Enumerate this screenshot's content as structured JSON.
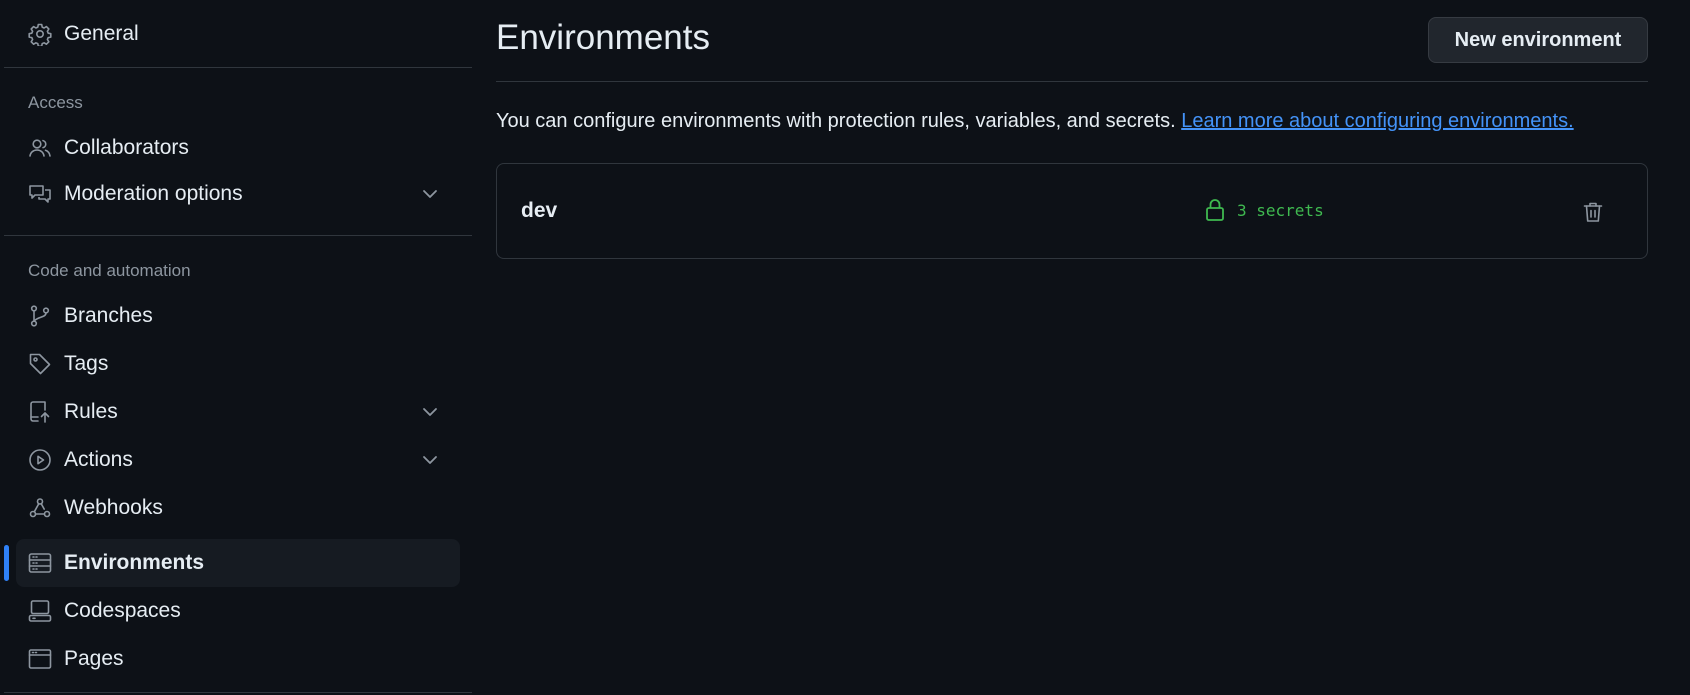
{
  "sidebar": {
    "general": "General",
    "access_heading": "Access",
    "collaborators": "Collaborators",
    "moderation": "Moderation options",
    "code_heading": "Code and automation",
    "branches": "Branches",
    "tags": "Tags",
    "rules": "Rules",
    "actions": "Actions",
    "webhooks": "Webhooks",
    "environments": "Environments",
    "codespaces": "Codespaces",
    "pages": "Pages",
    "active_item": "Environments"
  },
  "main": {
    "title": "Environments",
    "new_button": "New environment",
    "description": "You can configure environments with protection rules, variables, and secrets.",
    "learn_more": "Learn more about configuring environments.",
    "environments": [
      {
        "name": "dev",
        "secrets": "3 secrets"
      }
    ]
  },
  "colors": {
    "background": "#0d1117",
    "accent": "#2f81f7",
    "link": "#4493f8",
    "success": "#3fb950",
    "border": "#30363d"
  },
  "icons": {
    "general": "gear-icon",
    "collaborators": "people-icon",
    "moderation": "comment-discussion-icon",
    "branches": "git-branch-icon",
    "tags": "tag-icon",
    "rules": "repo-push-icon",
    "actions": "play-icon",
    "webhooks": "webhook-icon",
    "environments": "server-icon",
    "codespaces": "codespaces-icon",
    "pages": "browser-icon",
    "secrets": "lock-icon",
    "delete": "trash-icon"
  }
}
